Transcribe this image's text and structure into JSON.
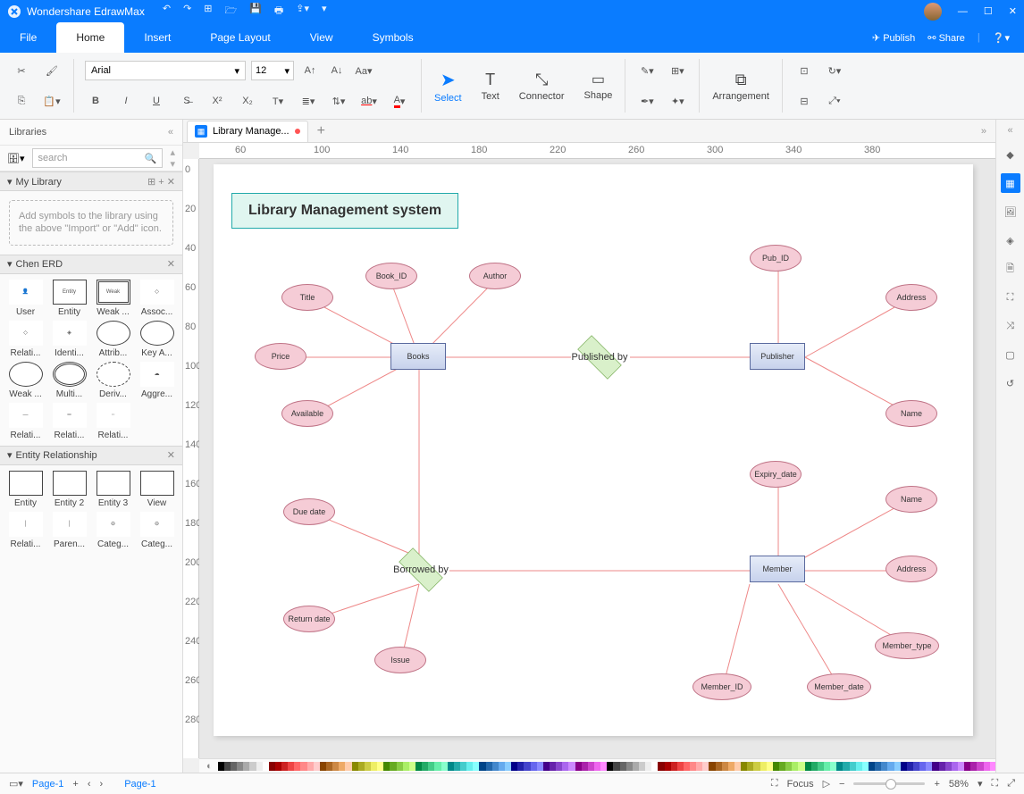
{
  "app": {
    "title": "Wondershare EdrawMax"
  },
  "menubar": {
    "file": "File",
    "home": "Home",
    "insert": "Insert",
    "pagelayout": "Page Layout",
    "view": "View",
    "symbols": "Symbols",
    "publish": "Publish",
    "share": "Share"
  },
  "ribbon": {
    "font": "Arial",
    "fontsize": "12",
    "select": "Select",
    "text": "Text",
    "connector": "Connector",
    "shape": "Shape",
    "arrangement": "Arrangement"
  },
  "left": {
    "title": "Libraries",
    "search_ph": "search",
    "mylib": "My Library",
    "hint": "Add symbols to the library using the above \"Import\" or \"Add\" icon.",
    "chen": "Chen ERD",
    "er": "Entity Relationship",
    "chen_items": [
      "User",
      "Entity",
      "Weak ...",
      "Assoc...",
      "Relati...",
      "Identi...",
      "Attrib...",
      "Key A...",
      "Weak ...",
      "Multi...",
      "Deriv...",
      "Aggre...",
      "Relati...",
      "Relati...",
      "Relati..."
    ],
    "er_items": [
      "Entity",
      "Entity 2",
      "Entity 3",
      "View",
      "Relati...",
      "Paren...",
      "Categ...",
      "Categ..."
    ]
  },
  "doc": {
    "tab": "Library Manage...",
    "pagetab": "Page-1"
  },
  "ruler_h": [
    "60",
    "100",
    "140",
    "180",
    "220",
    "260",
    "300",
    "340",
    "380"
  ],
  "ruler_v": [
    "0",
    "20",
    "40",
    "60",
    "80",
    "100",
    "120",
    "140",
    "160",
    "180",
    "200",
    "220",
    "240",
    "260",
    "280"
  ],
  "diagram": {
    "title": "Library Management system",
    "entities": {
      "books": "Books",
      "publisher": "Publisher",
      "member": "Member"
    },
    "relations": {
      "published": "Published by",
      "borrowed": "Borrowed by"
    },
    "attrs": {
      "bookid": "Book_ID",
      "author": "Author",
      "title": "Title",
      "price": "Price",
      "available": "Available",
      "pubid": "Pub_ID",
      "addr1": "Address",
      "name1": "Name",
      "duedate": "Due date",
      "returndate": "Return date",
      "issue": "Issue",
      "expiry": "Expiry_date",
      "name2": "Name",
      "addr2": "Address",
      "mtype": "Member_type",
      "mdate": "Member_date",
      "mid": "Member_ID"
    }
  },
  "status": {
    "page": "Page-1",
    "focus": "Focus",
    "zoom": "58%"
  }
}
